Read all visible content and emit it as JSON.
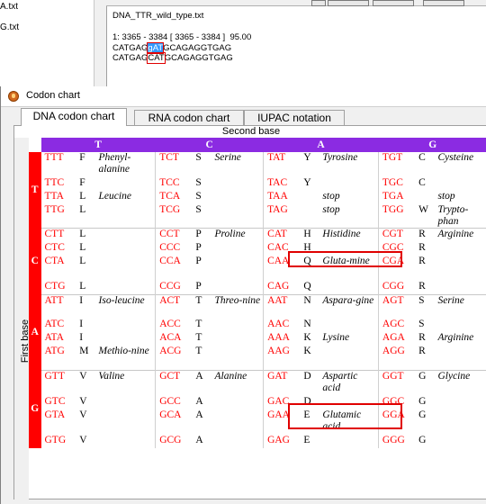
{
  "background": {
    "files": [
      "A.txt",
      "G.txt"
    ],
    "sequence_file": "DNA_TTR_wild_type.txt",
    "alignment_header": "1: 3365 - 3384 [ 3365 - 3384 ]  95.00",
    "line1_pre": "CATGAG",
    "line1_sel": "gAT",
    "line1_post": "GCAGAGGTGAG",
    "line2_pre": "CATGAG",
    "line2_box": "CAT",
    "line2_post": "GCAGAGGTGAG"
  },
  "dialog": {
    "title": "Codon chart",
    "tabs": [
      "DNA codon chart",
      "RNA codon chart",
      "IUPAC notation"
    ],
    "active_tab": "DNA codon chart"
  },
  "chart": {
    "second_base_label": "Second base",
    "first_base_label": "First base",
    "headers": [
      "T",
      "C",
      "A",
      "G"
    ],
    "colors": {
      "header_bg": "#8b2be2",
      "first_base_bg": "#ff0000",
      "codon_text": "#ff0000",
      "highlight": "#e00000"
    },
    "groups": [
      {
        "first": "T",
        "rows": [
          [
            [
              "TTT",
              "F",
              "Phenyl-alanine"
            ],
            [
              "TCT",
              "S",
              "Serine"
            ],
            [
              "TAT",
              "Y",
              "Tyrosine"
            ],
            [
              "TGT",
              "C",
              "Cysteine"
            ]
          ],
          [
            [
              "TTC",
              "F",
              ""
            ],
            [
              "TCC",
              "S",
              ""
            ],
            [
              "TAC",
              "Y",
              ""
            ],
            [
              "TGC",
              "C",
              ""
            ]
          ],
          [
            [
              "TTA",
              "L",
              "Leucine"
            ],
            [
              "TCA",
              "S",
              ""
            ],
            [
              "TAA",
              "",
              "stop"
            ],
            [
              "TGA",
              "",
              "stop"
            ]
          ],
          [
            [
              "TTG",
              "L",
              ""
            ],
            [
              "TCG",
              "S",
              ""
            ],
            [
              "TAG",
              "",
              "stop"
            ],
            [
              "TGG",
              "W",
              "Trypto-phan"
            ]
          ]
        ]
      },
      {
        "first": "C",
        "rows": [
          [
            [
              "CTT",
              "L",
              ""
            ],
            [
              "CCT",
              "P",
              "Proline"
            ],
            [
              "CAT",
              "H",
              "Histidine"
            ],
            [
              "CGT",
              "R",
              "Arginine"
            ]
          ],
          [
            [
              "CTC",
              "L",
              ""
            ],
            [
              "CCC",
              "P",
              ""
            ],
            [
              "CAC",
              "H",
              ""
            ],
            [
              "CGC",
              "R",
              ""
            ]
          ],
          [
            [
              "CTA",
              "L",
              ""
            ],
            [
              "CCA",
              "P",
              ""
            ],
            [
              "CAA",
              "Q",
              "Gluta-mine"
            ],
            [
              "CGA",
              "R",
              ""
            ]
          ],
          [
            [
              "CTG",
              "L",
              ""
            ],
            [
              "CCG",
              "P",
              ""
            ],
            [
              "CAG",
              "Q",
              ""
            ],
            [
              "CGG",
              "R",
              ""
            ]
          ]
        ]
      },
      {
        "first": "A",
        "rows": [
          [
            [
              "ATT",
              "I",
              "Iso-leucine"
            ],
            [
              "ACT",
              "T",
              "Threo-nine"
            ],
            [
              "AAT",
              "N",
              "Aspara-gine"
            ],
            [
              "AGT",
              "S",
              "Serine"
            ]
          ],
          [
            [
              "ATC",
              "I",
              ""
            ],
            [
              "ACC",
              "T",
              ""
            ],
            [
              "AAC",
              "N",
              ""
            ],
            [
              "AGC",
              "S",
              ""
            ]
          ],
          [
            [
              "ATA",
              "I",
              ""
            ],
            [
              "ACA",
              "T",
              ""
            ],
            [
              "AAA",
              "K",
              "Lysine"
            ],
            [
              "AGA",
              "R",
              "Arginine"
            ]
          ],
          [
            [
              "ATG",
              "M",
              "Methio-nine"
            ],
            [
              "ACG",
              "T",
              ""
            ],
            [
              "AAG",
              "K",
              ""
            ],
            [
              "AGG",
              "R",
              ""
            ]
          ]
        ]
      },
      {
        "first": "G",
        "rows": [
          [
            [
              "GTT",
              "V",
              "Valine"
            ],
            [
              "GCT",
              "A",
              "Alanine"
            ],
            [
              "GAT",
              "D",
              "Aspartic acid"
            ],
            [
              "GGT",
              "G",
              "Glycine"
            ]
          ],
          [
            [
              "GTC",
              "V",
              ""
            ],
            [
              "GCC",
              "A",
              ""
            ],
            [
              "GAC",
              "D",
              ""
            ],
            [
              "GGC",
              "G",
              ""
            ]
          ],
          [
            [
              "GTA",
              "V",
              ""
            ],
            [
              "GCA",
              "A",
              ""
            ],
            [
              "GAA",
              "E",
              "Glutamic acid"
            ],
            [
              "GGA",
              "G",
              ""
            ]
          ],
          [
            [
              "GTG",
              "V",
              ""
            ],
            [
              "GCG",
              "A",
              ""
            ],
            [
              "GAG",
              "E",
              ""
            ],
            [
              "GGG",
              "G",
              ""
            ]
          ]
        ]
      }
    ],
    "highlighted": [
      "CAT",
      "GAT"
    ]
  }
}
